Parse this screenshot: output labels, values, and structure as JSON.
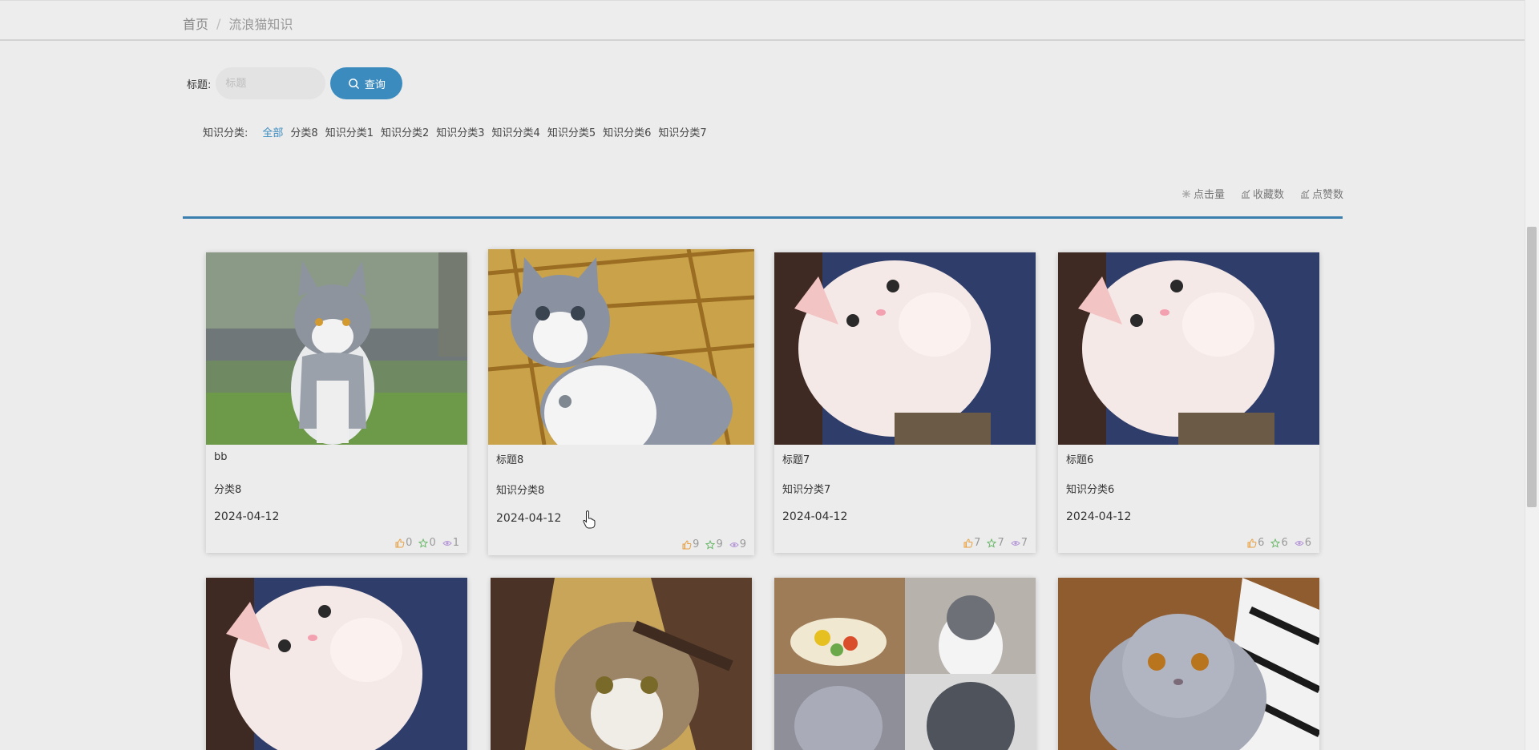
{
  "breadcrumb": {
    "home": "首页",
    "separator": "/",
    "current": "流浪猫知识"
  },
  "search": {
    "label": "标题:",
    "placeholder": "标题",
    "button": "查询"
  },
  "categories": {
    "label": "知识分类:",
    "items": [
      "全部",
      "分类8",
      "知识分类1",
      "知识分类2",
      "知识分类3",
      "知识分类4",
      "知识分类5",
      "知识分类6",
      "知识分类7"
    ],
    "active": "全部"
  },
  "sort": {
    "clicks": "点击量",
    "favorites": "收藏数",
    "likes": "点赞数"
  },
  "colors": {
    "accent": "#3b8bbf",
    "like": "#e8a041",
    "favorite": "#6ab86a",
    "view": "#b496d6"
  },
  "cards": [
    {
      "title": "bb",
      "category": "分类8",
      "date": "2024-04-12",
      "likes": "0",
      "favorites": "0",
      "views": "1",
      "image": "grey-white-cat-walking-on-grass"
    },
    {
      "title": "标题8",
      "category": "知识分类8",
      "date": "2024-04-12",
      "likes": "9",
      "favorites": "9",
      "views": "9",
      "image": "grey-white-kitten-on-rattan-chair"
    },
    {
      "title": "标题7",
      "category": "知识分类7",
      "date": "2024-04-12",
      "likes": "7",
      "favorites": "7",
      "views": "7",
      "image": "white-kitten-raising-paw"
    },
    {
      "title": "标题6",
      "category": "知识分类6",
      "date": "2024-04-12",
      "likes": "6",
      "favorites": "6",
      "views": "6",
      "image": "white-kitten-raising-paw"
    },
    {
      "image": "white-kitten-raising-paw"
    },
    {
      "image": "scottish-fold-tabby-cat"
    },
    {
      "image": "cat-collage"
    },
    {
      "image": "grey-scottish-fold-on-rug"
    }
  ]
}
